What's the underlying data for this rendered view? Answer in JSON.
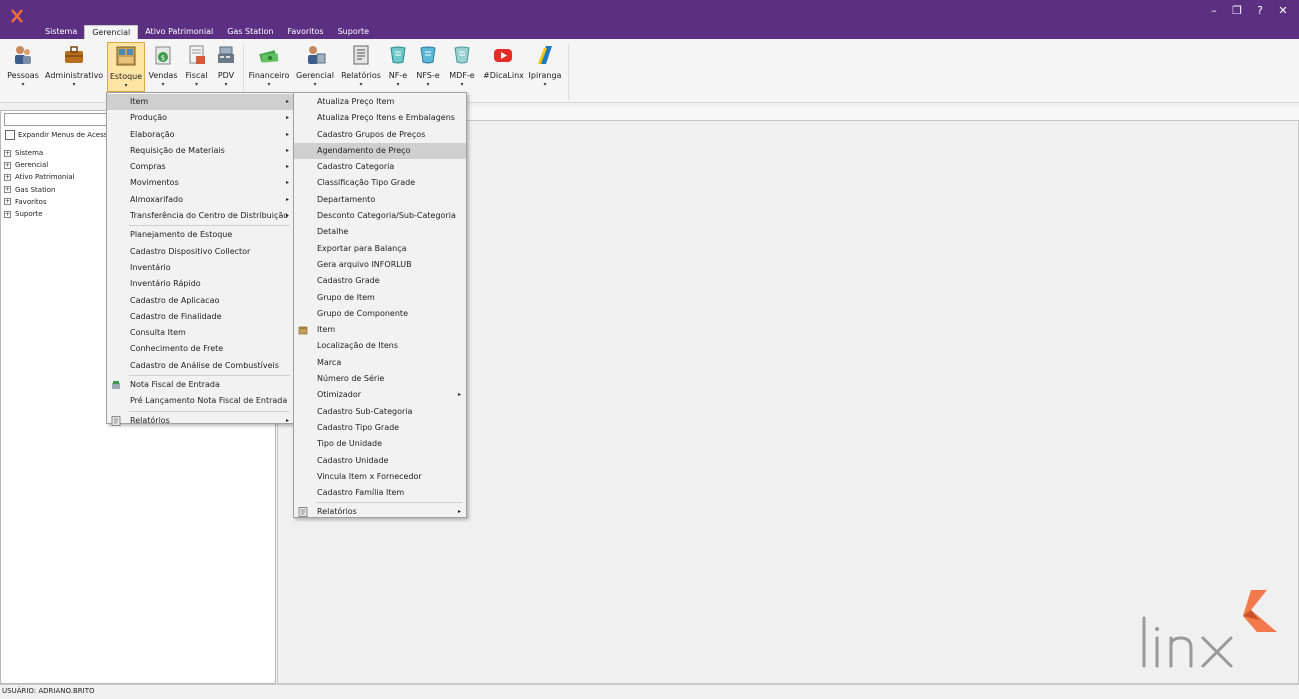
{
  "window": {
    "controls": {
      "minimize": "–",
      "restore": "❐",
      "help": "?",
      "close": "✕"
    }
  },
  "menubar": {
    "tabs": [
      "Sistema",
      "Gerencial",
      "Ativo Patrimonial",
      "Gas Station",
      "Favoritos",
      "Suporte"
    ],
    "active": "Gerencial"
  },
  "ribbon": {
    "buttons": [
      {
        "label": "Pessoas",
        "icon": "people-icon"
      },
      {
        "label": "Administrativo",
        "icon": "briefcase-icon"
      },
      {
        "label": "Estoque",
        "icon": "stock-icon"
      },
      {
        "label": "Vendas",
        "icon": "sales-icon"
      },
      {
        "label": "Fiscal",
        "icon": "fiscal-icon"
      },
      {
        "label": "PDV",
        "icon": "cash-register-icon"
      },
      {
        "label": "Financeiro",
        "icon": "money-icon"
      },
      {
        "label": "Gerencial",
        "icon": "management-icon"
      },
      {
        "label": "Relatórios",
        "icon": "report-icon"
      },
      {
        "label": "NF-e",
        "icon": "nfe-icon"
      },
      {
        "label": "NFS-e",
        "icon": "nfse-icon"
      },
      {
        "label": "MDF-e",
        "icon": "mdfe-icon"
      },
      {
        "label": "#DicaLinx",
        "icon": "youtube-icon"
      },
      {
        "label": "Ipiranga",
        "icon": "ipiranga-icon"
      }
    ],
    "selected": "Estoque"
  },
  "left_panel": {
    "search_value": "",
    "expand_label": "Expandir Menus de Acesso",
    "tree": [
      "Sistema",
      "Gerencial",
      "Ativo Patrimonial",
      "Gas Station",
      "Favoritos",
      "Suporte"
    ]
  },
  "estoque_menu": {
    "items": [
      {
        "label": "Item",
        "submenu": true
      },
      {
        "label": "Produção",
        "submenu": true
      },
      {
        "label": "Elaboração",
        "submenu": true
      },
      {
        "label": "Requisição de Materiais",
        "submenu": true
      },
      {
        "label": "Compras",
        "submenu": true
      },
      {
        "label": "Movimentos",
        "submenu": true
      },
      {
        "label": "Almoxarifado",
        "submenu": true
      },
      {
        "label": "Transferência do Centro de Distribuição",
        "submenu": true
      },
      {
        "label": "Planejamento de Estoque"
      },
      {
        "label": "Cadastro Dispositivo Collector"
      },
      {
        "label": "Inventário"
      },
      {
        "label": "Inventário Rápido"
      },
      {
        "label": "Cadastro de Aplicacao"
      },
      {
        "label": "Cadastro de Finalidade"
      },
      {
        "label": "Consulta Item"
      },
      {
        "label": "Conhecimento de Frete"
      },
      {
        "label": "Cadastro de Análise de Combustíveis"
      },
      {
        "label": "Nota Fiscal de Entrada"
      },
      {
        "label": "Pré Lançamento Nota Fiscal de Entrada"
      },
      {
        "label": "Relatórios",
        "submenu": true
      }
    ],
    "highlighted": "Item"
  },
  "item_menu": {
    "items": [
      {
        "label": "Atualiza Preço Item"
      },
      {
        "label": "Atualiza Preço Itens e Embalagens"
      },
      {
        "label": "Cadastro Grupos de Preços"
      },
      {
        "label": "Agendamento de Preço"
      },
      {
        "label": "Cadastro Categoria"
      },
      {
        "label": "Classificação Tipo Grade"
      },
      {
        "label": "Departamento"
      },
      {
        "label": "Desconto Categoria/Sub-Categoria"
      },
      {
        "label": "Detalhe"
      },
      {
        "label": "Exportar para Balança"
      },
      {
        "label": "Gera arquivo INFORLUB"
      },
      {
        "label": "Cadastro Grade"
      },
      {
        "label": "Grupo de Item"
      },
      {
        "label": "Grupo de Componente"
      },
      {
        "label": "Item"
      },
      {
        "label": "Localização de Itens"
      },
      {
        "label": "Marca"
      },
      {
        "label": "Número de Série"
      },
      {
        "label": "Otimizador",
        "submenu": true
      },
      {
        "label": "Cadastro Sub-Categoria"
      },
      {
        "label": "Cadastro Tipo Grade"
      },
      {
        "label": "Tipo de Unidade"
      },
      {
        "label": "Cadastro Unidade"
      },
      {
        "label": "Vincula Item x Fornecedor"
      },
      {
        "label": "Cadastro Família Item"
      },
      {
        "label": "Relatórios",
        "submenu": true
      }
    ],
    "highlighted": "Agendamento de Preço"
  },
  "status": {
    "user": "USUÁRIO: ADRIANO.BRITO"
  },
  "brand": {
    "logo_text": "linx",
    "accent": "#f26b38",
    "titlebar": "#5b2f82"
  }
}
